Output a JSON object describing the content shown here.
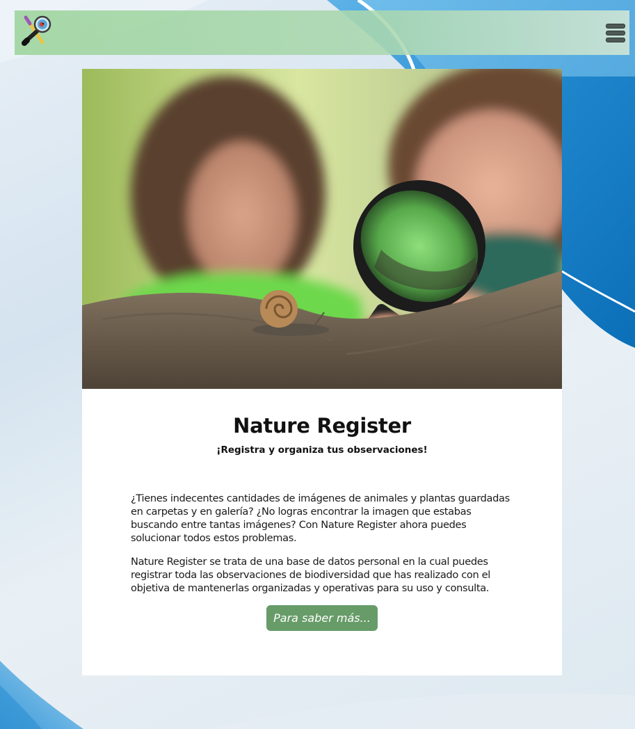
{
  "header": {
    "logo_icon": "magnifier-pencil-logo-icon",
    "menu_icon": "hamburger-menu-icon",
    "bar_color": "#a6d6a6"
  },
  "hero": {
    "image_subject": "children-magnifying-glass-snail-photo"
  },
  "main": {
    "title": "Nature Register",
    "subtitle": "¡Registra y organiza tus observaciones!",
    "paragraphs": [
      "¿Tienes indecentes cantidades de imágenes de animales y plantas guardadas en carpetas y en galería? ¿No logras encontrar la imagen que estabas buscando entre tantas imágenes? Con Nature Register ahora puedes solucionar todos estos problemas.",
      "Nature Register se trata de una base de datos personal en la cual puedes registrar toda las observaciones de biodiversidad que has realizado con el objetiva de mantenerlas organizadas y operativas para su uso y consulta."
    ],
    "more_button_label": "Para saber más...",
    "button_color": "#679c69"
  }
}
